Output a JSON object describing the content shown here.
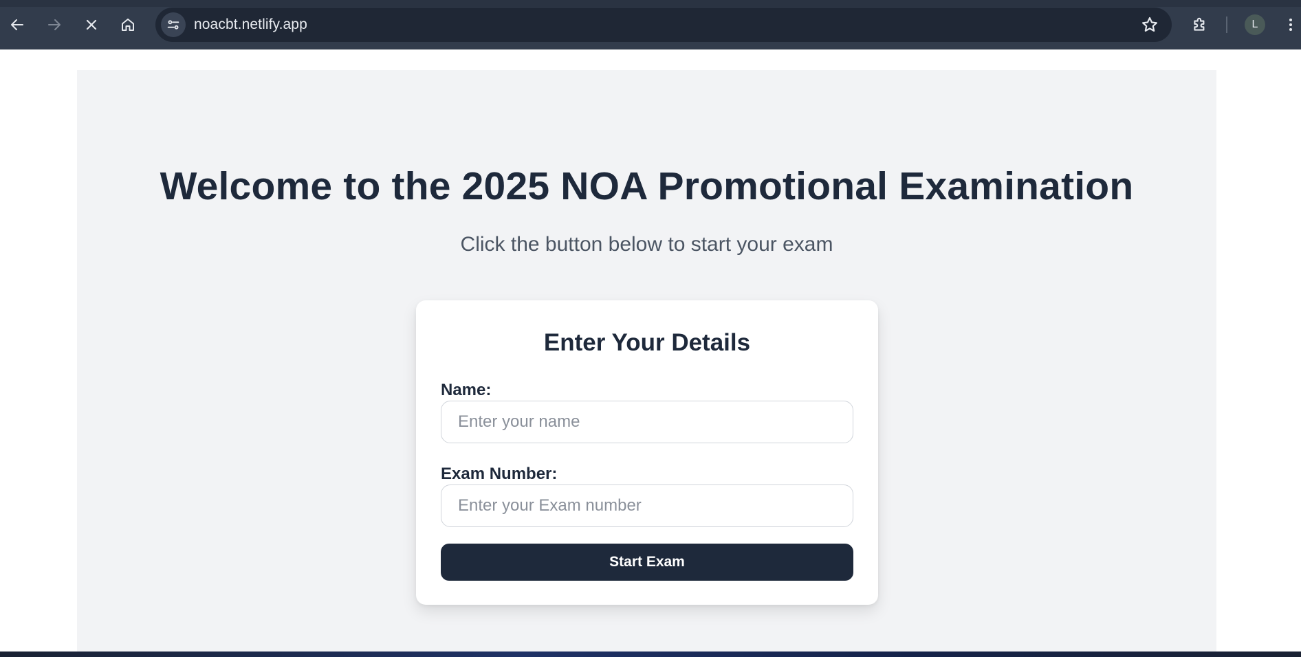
{
  "browser": {
    "url": "noacbt.netlify.app",
    "profile_initial": "L",
    "icons": {
      "back": "arrow-left-icon",
      "forward": "arrow-right-icon",
      "stop": "close-icon",
      "home": "home-icon",
      "site_info": "tune-icon",
      "bookmark": "star-icon",
      "extensions": "puzzle-icon",
      "menu": "kebab-menu-icon"
    }
  },
  "page": {
    "headline": "Welcome to the 2025 NOA Promotional Examination",
    "subtitle": "Click the button below to start your exam"
  },
  "form": {
    "title": "Enter Your Details",
    "name_label": "Name:",
    "name_value": "",
    "name_placeholder": "Enter your name",
    "exam_label": "Exam Number:",
    "exam_value": "",
    "exam_placeholder": "Enter your Exam number",
    "submit_label": "Start Exam"
  },
  "colors": {
    "chrome_bg": "#323c4c",
    "page_bg": "#f2f3f5",
    "primary": "#1e293b",
    "subtitle": "#4b5563"
  }
}
